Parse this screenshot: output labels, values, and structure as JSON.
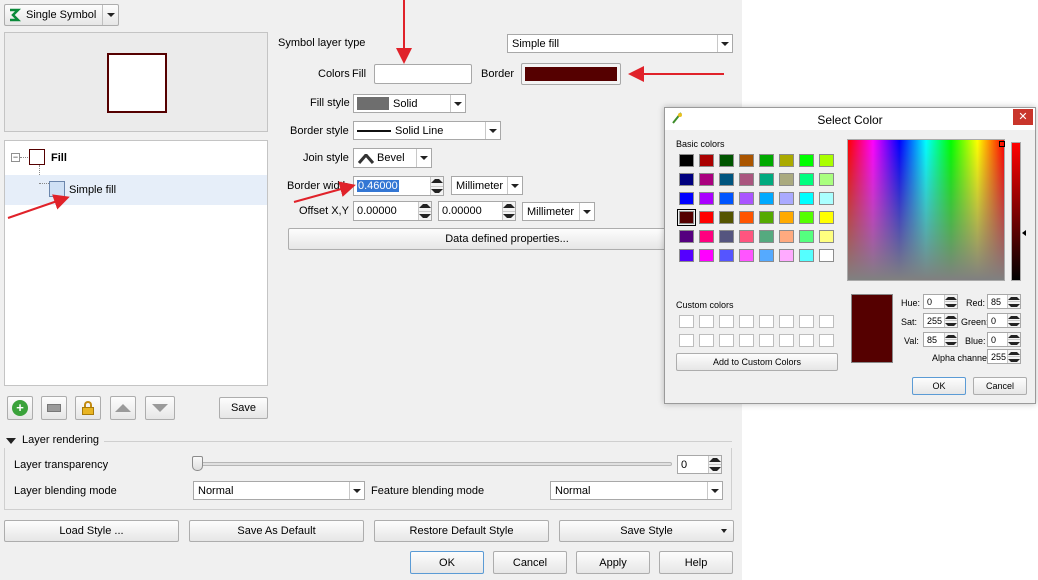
{
  "renderer": {
    "label": "Single Symbol"
  },
  "layer_tree": {
    "fill_label": "Fill",
    "simple_fill_label": "Simple fill",
    "save_label": "Save"
  },
  "symbol_layer": {
    "type_label": "Symbol layer type",
    "type_value": "Simple fill",
    "colors_label": "Colors",
    "fill_label": "Fill",
    "border_label": "Border",
    "fill_style_label": "Fill style",
    "fill_style_value": "Solid",
    "border_style_label": "Border style",
    "border_style_value": "Solid Line",
    "join_style_label": "Join style",
    "join_style_value": "Bevel",
    "border_width_label": "Border width",
    "border_width_value": "0.46000",
    "border_width_unit": "Millimeter",
    "offset_label": "Offset X,Y",
    "offset_x": "0.00000",
    "offset_y": "0.00000",
    "offset_unit": "Millimeter",
    "data_defined_label": "Data defined properties...",
    "border_color": "#550000"
  },
  "layer_rendering": {
    "header": "Layer rendering",
    "transparency_label": "Layer transparency",
    "transparency_value": "0",
    "blending_label": "Layer blending mode",
    "blending_value": "Normal",
    "feature_blending_label": "Feature blending mode",
    "feature_blending_value": "Normal"
  },
  "bottom_buttons": {
    "load_style": "Load Style ...",
    "save_default": "Save As Default",
    "restore_default": "Restore Default Style",
    "save_style": "Save Style",
    "ok": "OK",
    "cancel": "Cancel",
    "apply": "Apply",
    "help": "Help"
  },
  "color_dialog": {
    "title": "Select Color",
    "basic_colors_label": "Basic colors",
    "custom_colors_label": "Custom colors",
    "add_custom_label": "Add to Custom Colors",
    "hue_label": "Hue:",
    "hue_value": "0",
    "sat_label": "Sat:",
    "sat_value": "255",
    "val_label": "Val:",
    "val_value": "85",
    "red_label": "Red:",
    "red_value": "85",
    "green_label": "Green:",
    "green_value": "0",
    "blue_label": "Blue:",
    "blue_value": "0",
    "alpha_label": "Alpha channel:",
    "alpha_value": "255",
    "ok": "OK",
    "cancel": "Cancel",
    "current_color": "#550000",
    "basic_colors": [
      "#000000",
      "#aa0000",
      "#005500",
      "#aa5500",
      "#00aa00",
      "#aaaa00",
      "#00ff00",
      "#aaff00",
      "#00007f",
      "#aa007f",
      "#00557f",
      "#aa557f",
      "#00aa7f",
      "#aaaa7f",
      "#00ff7f",
      "#aaff7f",
      "#0000ff",
      "#aa00ff",
      "#0055ff",
      "#aa55ff",
      "#00aaff",
      "#aaaaff",
      "#00ffff",
      "#aaffff",
      "#550000",
      "#ff0000",
      "#555500",
      "#ff5500",
      "#55aa00",
      "#ffaa00",
      "#55ff00",
      "#ffff00",
      "#55007f",
      "#ff007f",
      "#55557f",
      "#ff557f",
      "#55aa7f",
      "#ffaa7f",
      "#55ff7f",
      "#ffff7f",
      "#5500ff",
      "#ff00ff",
      "#5555ff",
      "#ff55ff",
      "#55aaff",
      "#ffaaff",
      "#55ffff",
      "#ffffff"
    ]
  }
}
